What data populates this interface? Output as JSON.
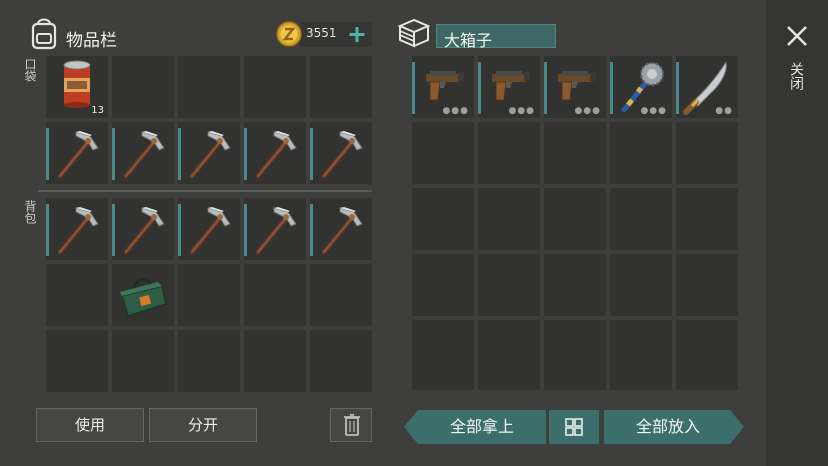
{
  "inventory": {
    "title": "物品栏",
    "pockets_label": "口袋",
    "backpack_label": "背包",
    "coins": "3551",
    "food_can_count": "13"
  },
  "container": {
    "title": "大箱子"
  },
  "close": {
    "label": "关闭"
  },
  "buttons": {
    "use": "使用",
    "split": "分开",
    "take_all": "全部拿上",
    "put_all": "全部放入"
  },
  "colors": {
    "accent_teal": "#3c6f6c",
    "coin_gold": "#d8a52a",
    "slot_bg": "#323331"
  },
  "icons": {
    "bag": "backpack-icon",
    "coin": "coin-icon",
    "plus": "plus-icon",
    "box": "crate-icon",
    "close": "close-icon",
    "trash": "trash-icon",
    "grid": "grid-icon"
  }
}
